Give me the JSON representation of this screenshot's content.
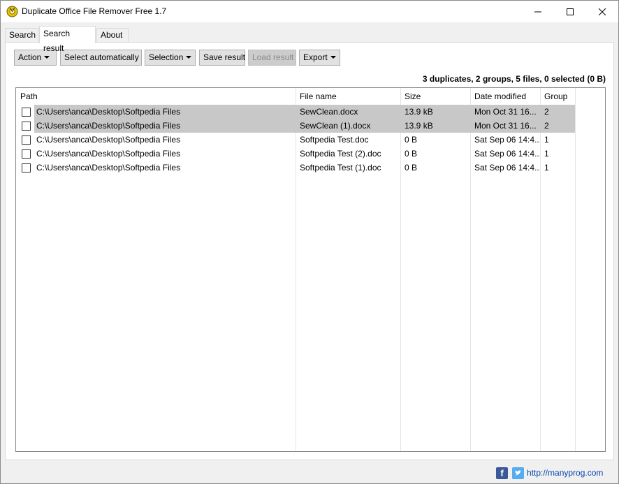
{
  "window": {
    "title": "Duplicate Office File Remover Free 1.7"
  },
  "tabs": [
    {
      "label": "Search",
      "active": false
    },
    {
      "label": "Search result",
      "active": true
    },
    {
      "label": "About",
      "active": false
    }
  ],
  "toolbar": {
    "action_label": "Action",
    "select_auto_label": "Select automatically",
    "selection_label": "Selection",
    "save_result_label": "Save result",
    "load_result_label": "Load result",
    "export_label": "Export"
  },
  "summary": "3 duplicates, 2 groups, 5 files, 0 selected (0 B)",
  "table": {
    "columns": [
      "Path",
      "File name",
      "Size",
      "Date modified",
      "Group"
    ],
    "rows": [
      {
        "path": "C:\\Users\\anca\\Desktop\\Softpedia Files",
        "name": "SewClean.docx",
        "size": "13.9 kB",
        "date": "Mon Oct 31 16...",
        "group": "2",
        "highlighted": true
      },
      {
        "path": "C:\\Users\\anca\\Desktop\\Softpedia Files",
        "name": "SewClean (1).docx",
        "size": "13.9 kB",
        "date": "Mon Oct 31 16...",
        "group": "2",
        "highlighted": true
      },
      {
        "path": "C:\\Users\\anca\\Desktop\\Softpedia Files",
        "name": "Softpedia Test.doc",
        "size": "0 B",
        "date": "Sat Sep 06 14:4...",
        "group": "1",
        "highlighted": false
      },
      {
        "path": "C:\\Users\\anca\\Desktop\\Softpedia Files",
        "name": "Softpedia Test (2).doc",
        "size": "0 B",
        "date": "Sat Sep 06 14:4...",
        "group": "1",
        "highlighted": false
      },
      {
        "path": "C:\\Users\\anca\\Desktop\\Softpedia Files",
        "name": "Softpedia Test (1).doc",
        "size": "0 B",
        "date": "Sat Sep 06 14:4...",
        "group": "1",
        "highlighted": false
      }
    ]
  },
  "footer": {
    "link": "http://manyprog.com",
    "facebook_icon": "facebook-icon",
    "twitter_icon": "twitter-icon"
  },
  "colors": {
    "highlight": "#c8c8c8",
    "button_bg": "#e1e1e1",
    "link": "#0645ad"
  }
}
